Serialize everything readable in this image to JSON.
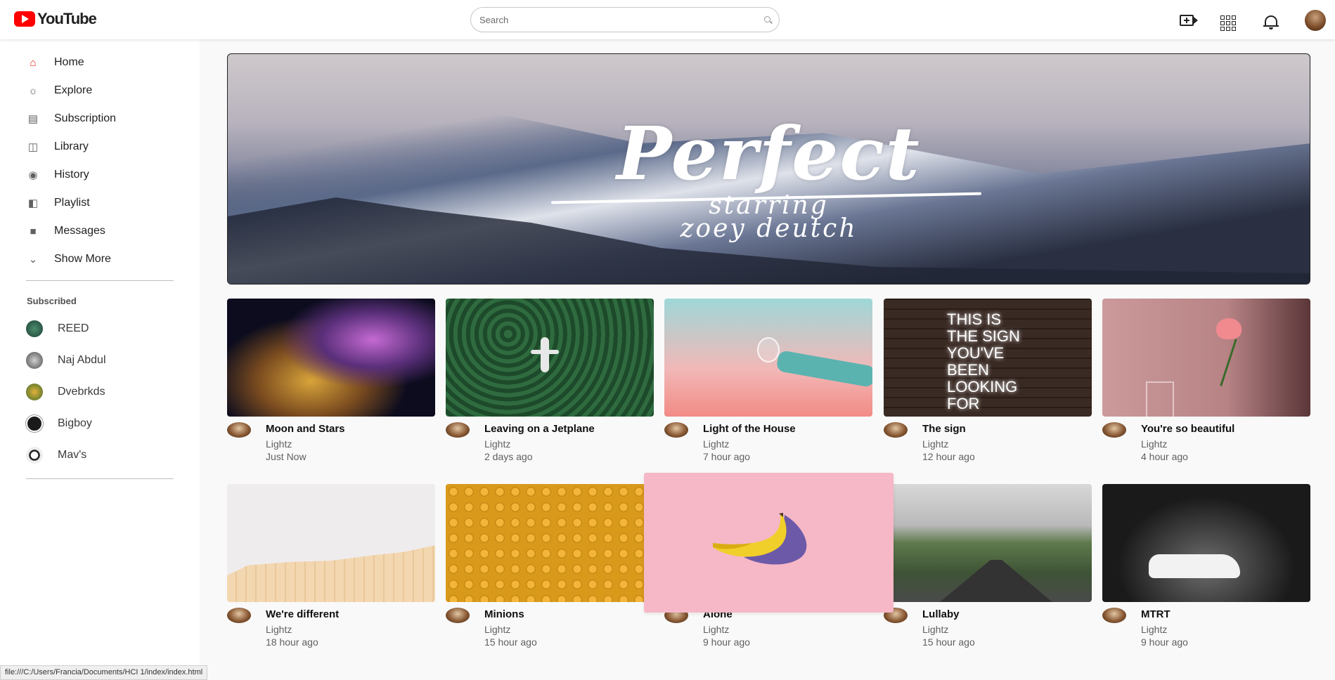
{
  "header": {
    "logo_text": "YouTube",
    "search_placeholder": "Search",
    "icons": [
      "video-create-icon",
      "apps-icon",
      "bell-icon"
    ],
    "brand_color": "#ff0000"
  },
  "sidebar": {
    "items": [
      {
        "label": "Home",
        "icon": "home-icon"
      },
      {
        "label": "Explore",
        "icon": "explore-icon"
      },
      {
        "label": "Subscription",
        "icon": "subscription-icon"
      },
      {
        "label": "Library",
        "icon": "library-icon"
      },
      {
        "label": "History",
        "icon": "history-icon"
      },
      {
        "label": "Playlist",
        "icon": "playlist-icon"
      },
      {
        "label": "Messages",
        "icon": "messages-icon"
      },
      {
        "label": "Show More",
        "icon": "chevron-down-icon"
      }
    ],
    "subscribed_title": "Subscribed",
    "subscriptions": [
      {
        "name": "REED"
      },
      {
        "name": "Naj Abdul"
      },
      {
        "name": "Dvebrkds"
      },
      {
        "name": "Bigboy"
      },
      {
        "name": "Mav's"
      }
    ]
  },
  "banner": {
    "title": "Perfect",
    "line1": "starring",
    "line2": "zoey deutch"
  },
  "videos": [
    {
      "title": "Moon and Stars",
      "channel": "Lightz",
      "time": "Just Now"
    },
    {
      "title": "Leaving on a Jetplane",
      "channel": "Lightz",
      "time": "2 days ago"
    },
    {
      "title": "Light of the House",
      "channel": "Lightz",
      "time": "7 hour ago"
    },
    {
      "title": "The sign",
      "channel": "Lightz",
      "time": "12 hour ago"
    },
    {
      "title": "You're so beautiful",
      "channel": "Lightz",
      "time": "4 hour ago"
    },
    {
      "title": "We're different",
      "channel": "Lightz",
      "time": "18 hour ago"
    },
    {
      "title": "Minions",
      "channel": "Lightz",
      "time": "15 hour ago"
    },
    {
      "title": "Alone",
      "channel": "Lightz",
      "time": "9 hour ago"
    },
    {
      "title": "Lullaby",
      "channel": "Lightz",
      "time": "15 hour ago"
    },
    {
      "title": "MTRT",
      "channel": "Lightz",
      "time": "9 hour ago"
    }
  ],
  "neon_text": "THIS IS THE SIGN YOU'VE BEEN LOOKING FOR",
  "status_bar": "file:///C:/Users/Francia/Documents/HCI 1/index/index.html"
}
